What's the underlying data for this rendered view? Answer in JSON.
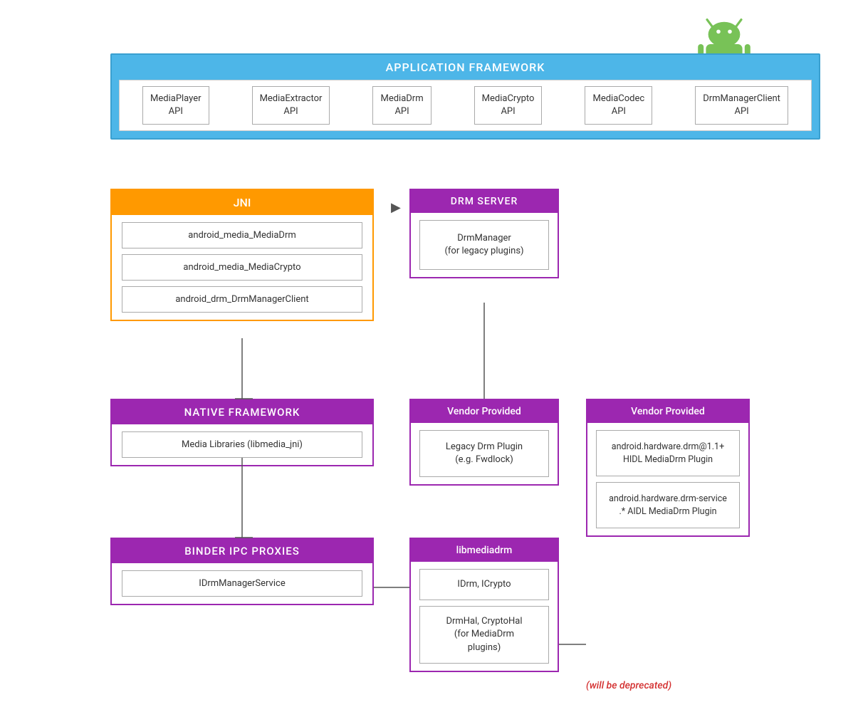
{
  "android_logo": {
    "alt": "Android Logo"
  },
  "app_framework": {
    "title": "APPLICATION FRAMEWORK",
    "apis": [
      {
        "label": "MediaPlayer\nAPI"
      },
      {
        "label": "MediaExtractor\nAPI"
      },
      {
        "label": "MediaDrm\nAPI"
      },
      {
        "label": "MediaCrypto\nAPI"
      },
      {
        "label": "MediaCodec\nAPI"
      },
      {
        "label": "DrmManagerClient\nAPI"
      }
    ]
  },
  "jni": {
    "title": "JNI",
    "items": [
      "android_media_MediaDrm",
      "android_media_MediaCrypto",
      "android_drm_DrmManagerClient"
    ]
  },
  "native_framework": {
    "title": "NATIVE FRAMEWORK",
    "items": [
      "Media Libraries (libmedia_jni)"
    ]
  },
  "binder_ipc": {
    "title": "BINDER IPC PROXIES",
    "items": [
      "IDrmManagerService"
    ]
  },
  "drm_server": {
    "title": "DRM SERVER",
    "items": [
      "DrmManager\n(for legacy plugins)"
    ]
  },
  "vendor_left": {
    "title": "Vendor Provided",
    "items": [
      "Legacy Drm Plugin\n(e.g. Fwdlock)"
    ]
  },
  "libmediadrm": {
    "title": "libmediadrm",
    "items": [
      "IDrm, ICrypto",
      "DrmHal, CryptoHal\n(for MediaDrm\nplugins)"
    ]
  },
  "vendor_right": {
    "title": "Vendor Provided",
    "items": [
      "android.hardware.drm@1.1+\nHIDL MediaDrm Plugin",
      "android.hardware.drm-service\n.* AIDL MediaDrm Plugin"
    ]
  },
  "deprecated": {
    "text": "(will be deprecated)"
  }
}
